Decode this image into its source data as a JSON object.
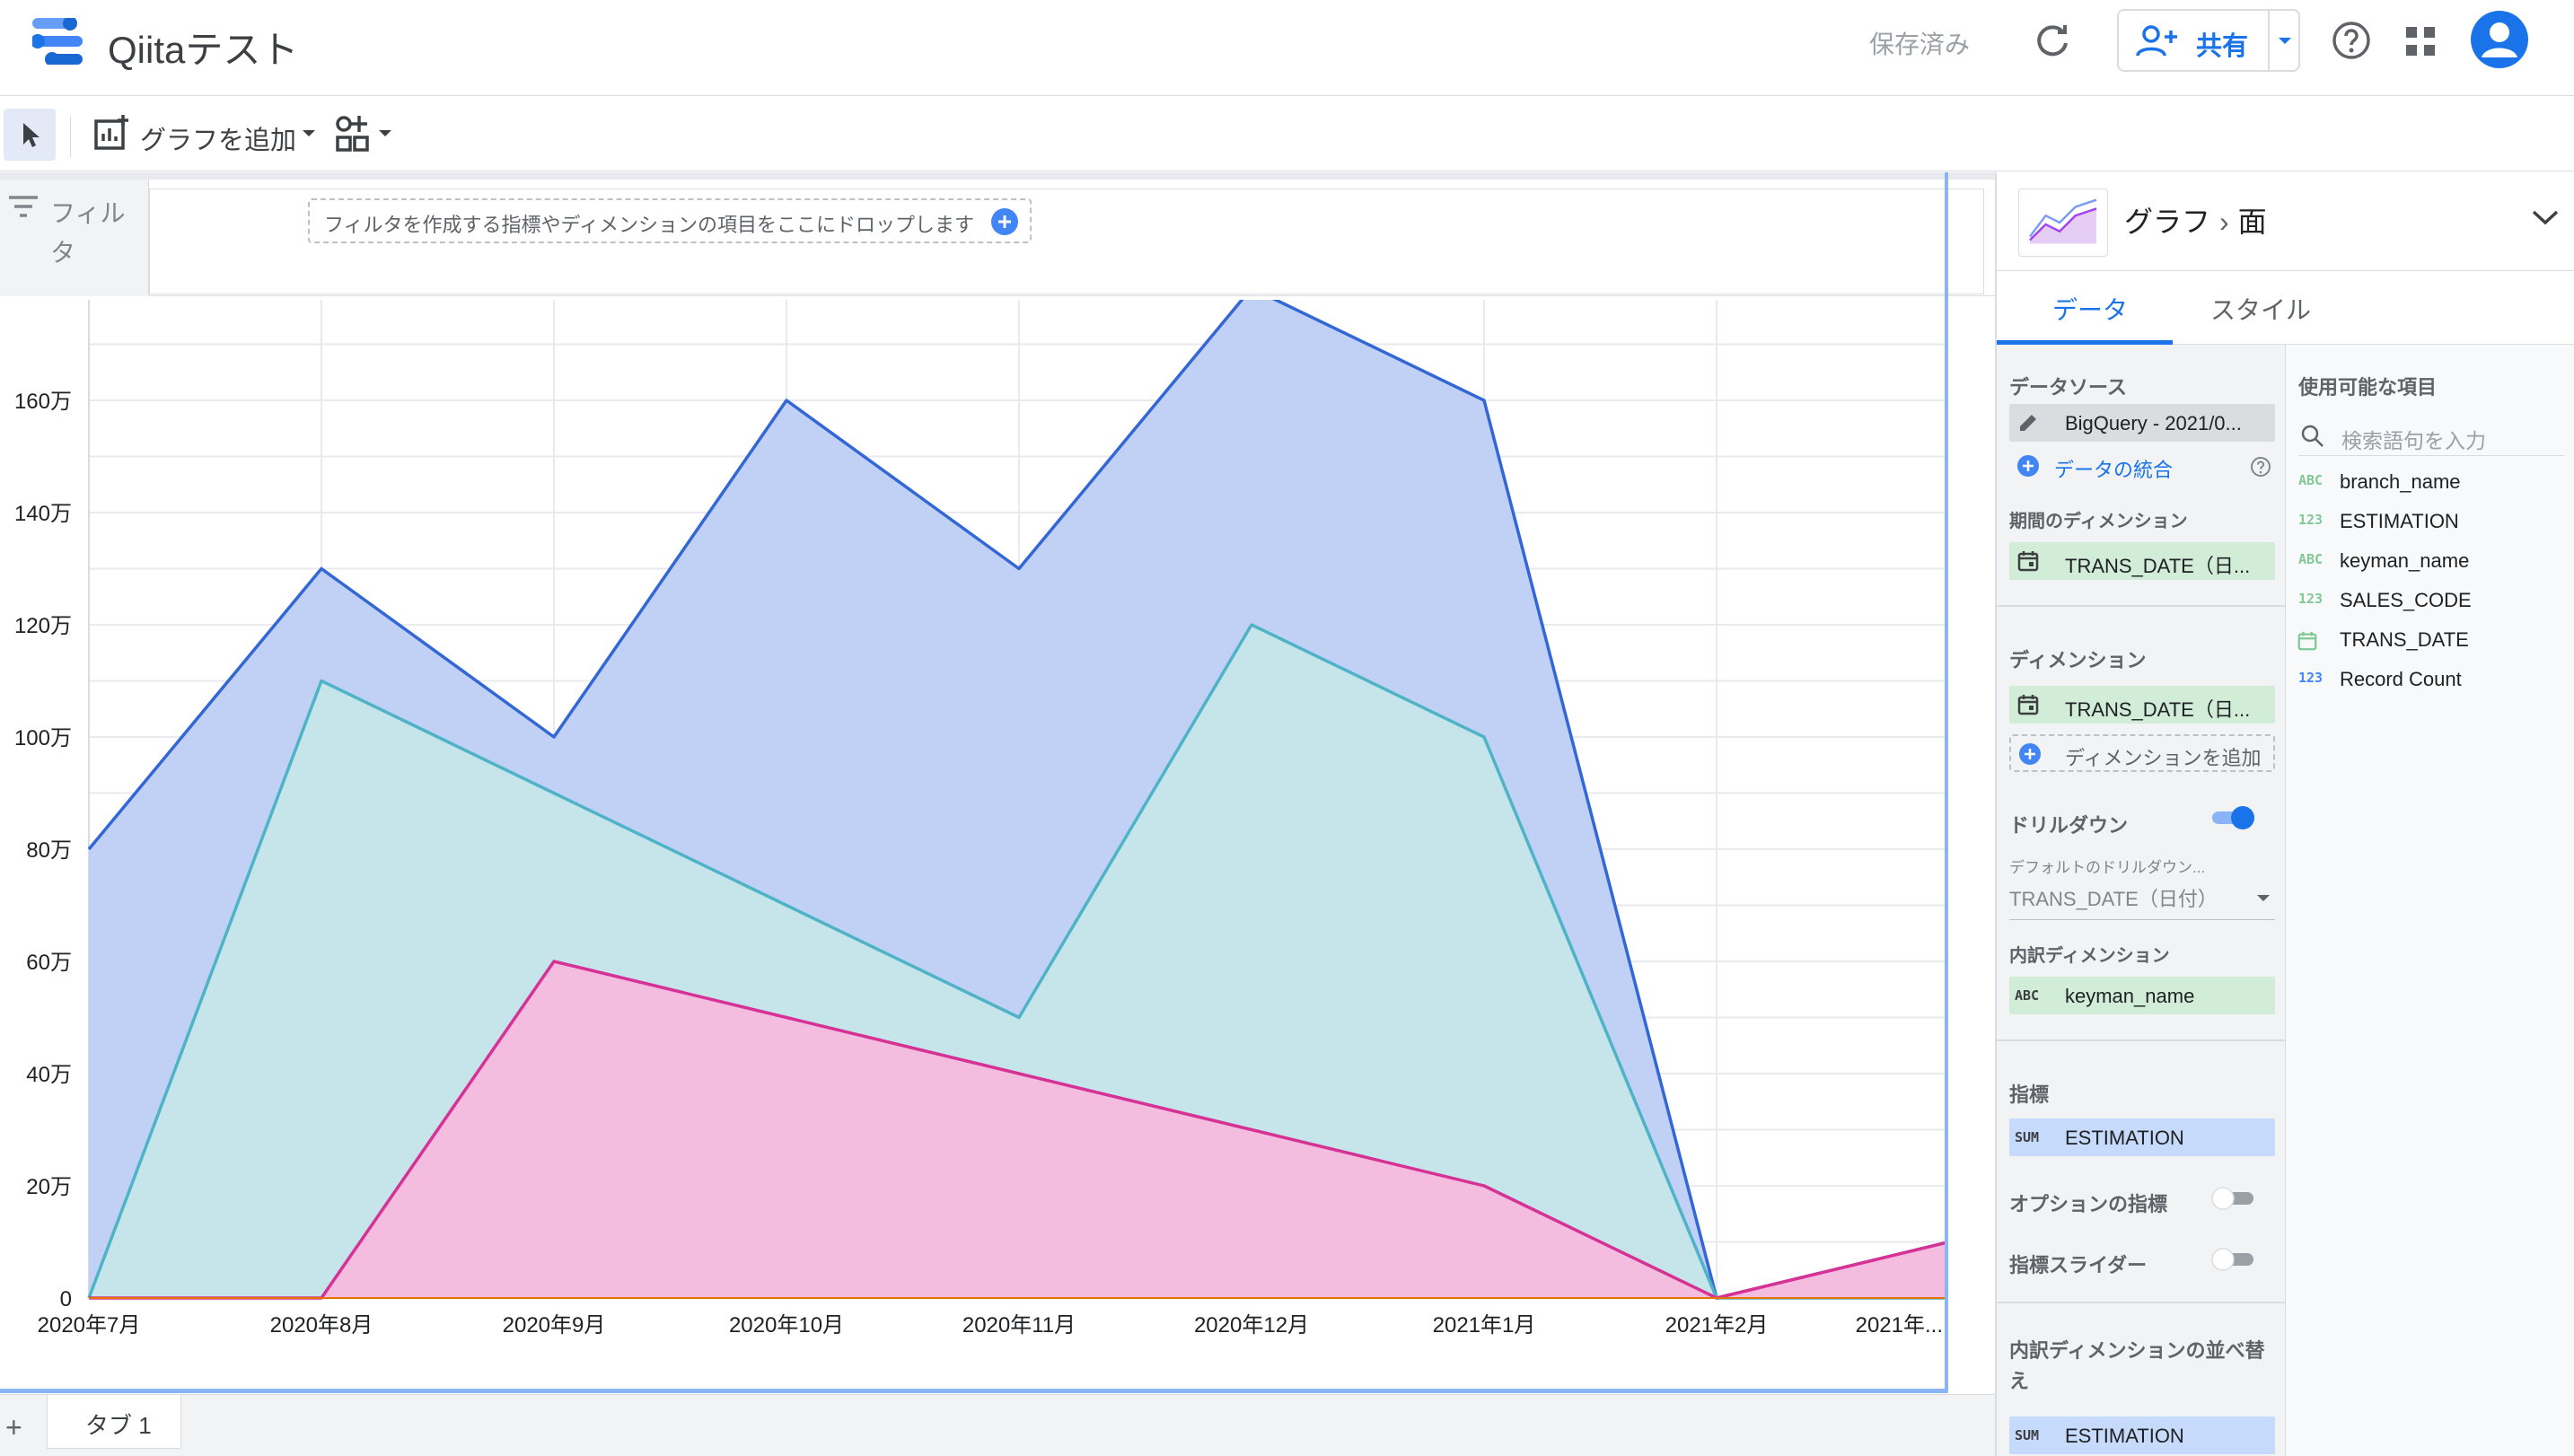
{
  "header": {
    "app_title": "Qiitaテスト",
    "saved_status": "保存済み",
    "share_label": "共有"
  },
  "toolbar": {
    "add_chart_label": "グラフを追加"
  },
  "filter_bar": {
    "label": "フィルタ",
    "drop_hint": "フィルタを作成する指標やディメンションの項目をここにドロップします"
  },
  "tabs_bar": {
    "add": "+",
    "tab1": "タブ 1"
  },
  "panel": {
    "title_type": "グラフ",
    "title_subtype": "面",
    "tab_data": "データ",
    "tab_style": "スタイル",
    "datasource_title": "データソース",
    "datasource_value": "BigQuery - 2021/0...",
    "blend_link": "データの統合",
    "period_dim_title": "期間のディメンション",
    "period_dim_value": "TRANS_DATE（日...",
    "dimension_title": "ディメンション",
    "dimension_value": "TRANS_DATE（日...",
    "add_dimension": "ディメンションを追加",
    "drilldown_title": "ドリルダウン",
    "default_drill_title": "デフォルトのドリルダウン...",
    "default_drill_value": "TRANS_DATE（日付）",
    "breakdown_title": "内訳ディメンション",
    "breakdown_value": "keyman_name",
    "metric_title": "指標",
    "metric_value": "ESTIMATION",
    "metric_agg": "SUM",
    "optional_metric_title": "オプションの指標",
    "metric_slider_title": "指標スライダー",
    "breakdown_sort_title": "内訳ディメンションの並べ替え",
    "breakdown_sort_value": "ESTIMATION",
    "breakdown_sort_agg": "SUM",
    "available_title": "使用可能な項目",
    "search_placeholder": "検索語句を入力",
    "fields": [
      {
        "type": "ABC",
        "name": "branch_name",
        "color": "#81c995"
      },
      {
        "type": "123",
        "name": "ESTIMATION",
        "color": "#81c995"
      },
      {
        "type": "ABC",
        "name": "keyman_name",
        "color": "#81c995"
      },
      {
        "type": "123",
        "name": "SALES_CODE",
        "color": "#81c995"
      },
      {
        "type": "date",
        "name": "TRANS_DATE",
        "color": "#81c995"
      },
      {
        "type": "123",
        "name": "Record Count",
        "color": "#4285f4"
      }
    ],
    "colors": {
      "dimension_chip": "#d1ecd7",
      "metric_chip": "#c6dafc",
      "accent": "#1a73e8"
    }
  },
  "chart_data": {
    "type": "area",
    "stacking": "overlapping",
    "categories": [
      "2020年7月",
      "2020年8月",
      "2020年9月",
      "2020年10月",
      "2020年11月",
      "2020年12月",
      "2021年1月",
      "2021年2月",
      "2021年..."
    ],
    "y_ticks": [
      "0",
      "20万",
      "40万",
      "60万",
      "80万",
      "100万",
      "120万",
      "140万",
      "160万"
    ],
    "ylim": [
      0,
      1750000
    ],
    "grid": true,
    "series": [
      {
        "values": [
          800000,
          1300000,
          1000000,
          1600000,
          1300000,
          1800000,
          1600000,
          0,
          100000
        ],
        "stroke": "#3367d6",
        "fill": "#c1d0f5"
      },
      {
        "values": [
          0,
          1100000,
          900000,
          700000,
          500000,
          1200000,
          1000000,
          0,
          0
        ],
        "stroke": "#4fb3c8",
        "fill": "#c5e5ea"
      },
      {
        "values": [
          0,
          0,
          600000,
          500000,
          400000,
          300000,
          200000,
          0,
          100000
        ],
        "stroke": "#d63296",
        "fill": "#f4bde0"
      }
    ]
  }
}
